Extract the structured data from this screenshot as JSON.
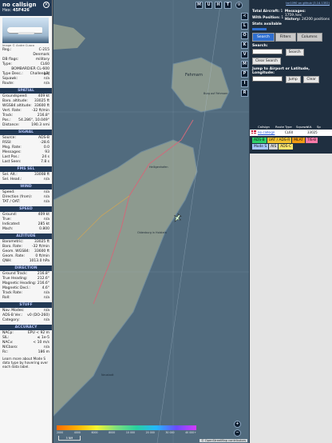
{
  "left": {
    "callsign": "no callsign",
    "hex_label": "Hex:",
    "hex": "45F426",
    "photo_credit": "Image © Andre Cuaco",
    "basic": [
      {
        "k": "Reg.:",
        "v": "C-215"
      },
      {
        "k": "",
        "v": "Denmark"
      },
      {
        "k": "DB flags:",
        "v": "military"
      },
      {
        "k": "Type:",
        "v": "CL60"
      },
      {
        "k": "",
        "v": "BOMBARDIER CL-600 Challenger"
      },
      {
        "k": "Type Desc.:",
        "v": "L2J"
      },
      {
        "k": "Squawk:",
        "v": "n/a"
      },
      {
        "k": "Route:",
        "v": "n/a"
      }
    ],
    "sections": [
      {
        "title": "SPATIAL",
        "rows": [
          {
            "k": "Groundspeed:",
            "v": "409 kt"
          },
          {
            "k": "Baro. altitude:",
            "v": "33025 ft"
          },
          {
            "k": "WGS84 altitude:",
            "v": "33600 ft"
          },
          {
            "k": "Vert. Rate:",
            "v": "-32 ft/min"
          },
          {
            "k": "Track:",
            "v": "216.8°"
          },
          {
            "k": "Pos.:",
            "v": "54.286°, 10.049°"
          },
          {
            "k": "Distance:",
            "v": "190.3 nmi"
          }
        ]
      },
      {
        "title": "SIGNAL",
        "rows": [
          {
            "k": "Source:",
            "v": "ADS-B"
          },
          {
            "k": "RSSI:",
            "v": "-28.6"
          },
          {
            "k": "Msg. Rate:",
            "v": "0.0"
          },
          {
            "k": "Messages:",
            "v": "93"
          },
          {
            "k": "Last Pos.:",
            "v": "24 s"
          },
          {
            "k": "Last Seen:",
            "v": "7.8 s"
          }
        ]
      },
      {
        "title": "FMS SEL",
        "rows": [
          {
            "k": "Sel. Alt.:",
            "v": "33008 ft"
          },
          {
            "k": "Sel. Head.:",
            "v": "n/a"
          }
        ]
      },
      {
        "title": "WIND",
        "rows": [
          {
            "k": "Speed:",
            "v": "n/a"
          },
          {
            "k": "Direction (from):",
            "v": "n/a"
          },
          {
            "k": "TAT / OAT:",
            "v": "n/a"
          }
        ]
      },
      {
        "title": "SPEED",
        "rows": [
          {
            "k": "Ground:",
            "v": "409 kt"
          },
          {
            "k": "True:",
            "v": "n/a"
          },
          {
            "k": "Indicated:",
            "v": "285 kt"
          },
          {
            "k": "Mach:",
            "v": "0.800"
          }
        ]
      },
      {
        "title": "ALTITUDE",
        "rows": [
          {
            "k": "Barometric:",
            "v": "33025 ft"
          },
          {
            "k": "Baro. Rate:",
            "v": "-32 ft/min"
          },
          {
            "k": "Geom. WGS84:",
            "v": "33600 ft"
          },
          {
            "k": "Geom. Rate:",
            "v": "0 ft/min"
          },
          {
            "k": "QNH:",
            "v": "1013.0 hPa"
          }
        ]
      },
      {
        "title": "DIRECTION",
        "rows": [
          {
            "k": "Ground Track:",
            "v": "216.8°"
          },
          {
            "k": "True Heading:",
            "v": "212.6°"
          },
          {
            "k": "Magnetic Heading:",
            "v": "216.6°"
          },
          {
            "k": "Magnetic Decl.:",
            "v": "4.6°"
          },
          {
            "k": "Track Rate:",
            "v": "n/a"
          },
          {
            "k": "Roll:",
            "v": "n/a"
          }
        ]
      },
      {
        "title": "STUFF",
        "rows": [
          {
            "k": "Nav. Modes:",
            "v": "n/a"
          },
          {
            "k": "ADS-B Ver.:",
            "v": "v0 (DO-260)"
          },
          {
            "k": "Category:",
            "v": "n/a"
          }
        ]
      },
      {
        "title": "ACCURACY",
        "rows": [
          {
            "k": "NACp:",
            "v": "EPU < 92 m"
          },
          {
            "k": "SIL:",
            "v": "≤ 1e-5"
          },
          {
            "k": "NACv:",
            "v": "< 10 m/s"
          },
          {
            "k": "NICbaro:",
            "v": "n/a"
          },
          {
            "k": "Rc:",
            "v": "186 m"
          }
        ]
      }
    ],
    "note": "Learn more about Mode S data type by hovering over each data label."
  },
  "map": {
    "buttons_top": [
      "M",
      "U",
      "H",
      "T"
    ],
    "side_buttons": [
      "<",
      "L",
      "O",
      "K",
      "V",
      "M",
      "P",
      "I",
      "R"
    ],
    "labels": {
      "island": "Fehmarn",
      "town": "Burg auf Fehmarn",
      "oldenburg": "Oldenburg in Holstein",
      "neustadt": "Neustadt",
      "heiligenhafen": "Heiligenhafen"
    },
    "zoom_in": "+",
    "zoom_out": "−",
    "scale_label": "5 NM",
    "attribution": "© OpenStreetMap contributors",
    "altitude_ticks": [
      "2000",
      "4000",
      "6000",
      "8000",
      "10 000",
      "20 000",
      "30 000",
      "40 000+"
    ]
  },
  "right": {
    "top_link": "tar1090 on github (3.14.1352)",
    "stats": {
      "total_label": "Total Aircraft:",
      "total": "1",
      "pos_label": "With Position:",
      "pos": "1",
      "messages_label": "Messages:",
      "messages": "1759 /sec",
      "history_label": "History:",
      "history": "24200 positions",
      "stats": "Stats available"
    },
    "tabs": [
      "Search",
      "Filters",
      "Columns"
    ],
    "search_label": "Search:",
    "search_button": "Search",
    "clear_button": "Clear Search",
    "jump_label": "Jump to Airport or Latitude, Longitude:",
    "jump_button": "Jump",
    "clear2_button": "Clear",
    "table_headers": [
      "",
      "Callsign",
      "Route",
      "Type",
      "Squawk",
      "Alt. (ft)",
      "Sp"
    ],
    "table_rows": [
      {
        "flag": "dk",
        "callsign": "no callsign",
        "route": "",
        "type": "CL60",
        "squawk": "",
        "alt": "33025",
        "sp": ""
      }
    ],
    "legend": [
      "ADS-B",
      "UAT / ADS-R",
      "MLAT",
      "TIS-B",
      "Mode S",
      "AIS",
      "ADS-C"
    ],
    "legend_colors": [
      "#2fd06a",
      "#f3c230",
      "#f39c12",
      "#ff7aa8",
      "#a7c7ff",
      "#d7d7d7",
      "#ffe66d"
    ]
  }
}
